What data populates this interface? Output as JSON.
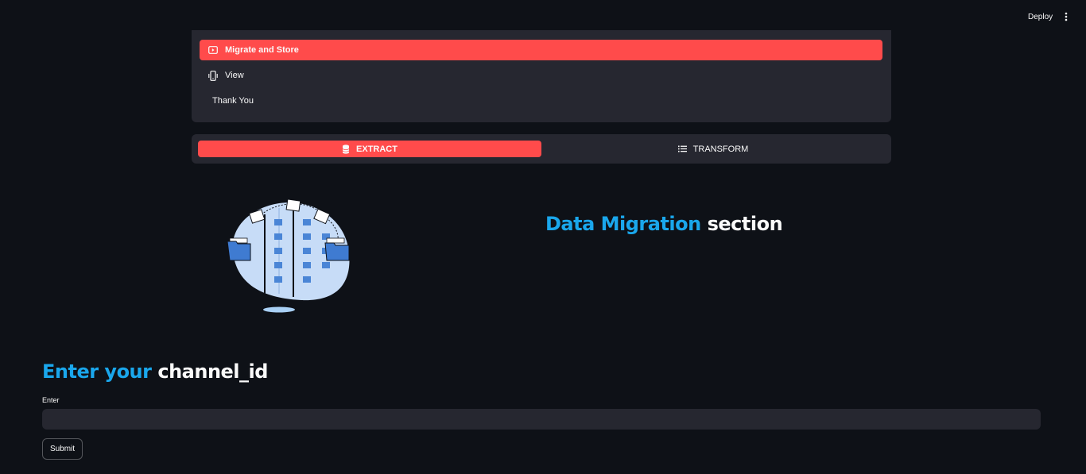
{
  "header": {
    "deploy_label": "Deploy",
    "menu_icon": "more-vertical-icon"
  },
  "menu": {
    "items": [
      {
        "label": "Migrate and Store",
        "icon": "video-icon",
        "active": true
      },
      {
        "label": "View",
        "icon": "phone-icon",
        "active": false
      },
      {
        "label": "Thank You",
        "icon": "",
        "active": false
      }
    ]
  },
  "tabs": [
    {
      "label": "EXTRACT",
      "icon": "database-icon",
      "active": true
    },
    {
      "label": "TRANSFORM",
      "icon": "list-icon",
      "active": false
    }
  ],
  "section": {
    "accent": "Data Migration",
    "rest": "section"
  },
  "channel": {
    "title_accent": "Enter your",
    "title_rest": "channel_id",
    "input_label": "Enter",
    "input_value": "",
    "submit_label": "Submit"
  },
  "colors": {
    "background": "#0e1117",
    "panel": "#262730",
    "primary": "#ff4b4b",
    "accent": "#1aa7ec"
  }
}
